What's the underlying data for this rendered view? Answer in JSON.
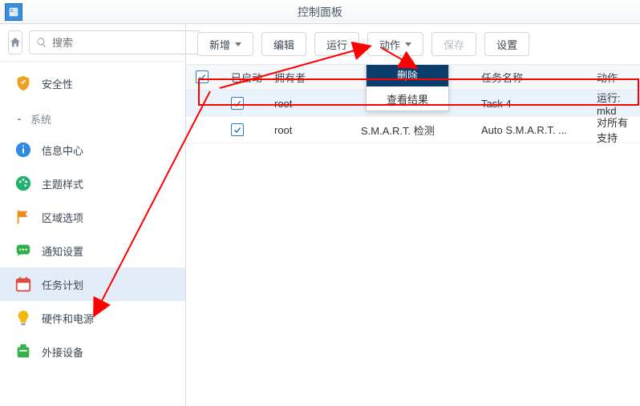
{
  "title": "控制面板",
  "search": {
    "placeholder": "搜索"
  },
  "sidebar": {
    "items": [
      {
        "label": "安全性"
      },
      {
        "label": "信息中心"
      },
      {
        "label": "主题样式"
      },
      {
        "label": "区域选项"
      },
      {
        "label": "通知设置"
      },
      {
        "label": "任务计划"
      },
      {
        "label": "硬件和电源"
      },
      {
        "label": "外接设备"
      }
    ],
    "group": "系统"
  },
  "toolbar": {
    "add": "新增",
    "edit": "编辑",
    "run": "运行",
    "action": "动作",
    "save": "保存",
    "settings": "设置"
  },
  "dropdown": {
    "delete": "删除",
    "view_result": "查看结果"
  },
  "table": {
    "headers": {
      "enabled": "已启动",
      "owner": "拥有者",
      "task_name": "任务名称",
      "action": "动作"
    },
    "rows": [
      {
        "enabled": true,
        "owner": "root",
        "type_masked": "",
        "name": "Task 4",
        "action": "运行: mkd"
      },
      {
        "enabled": true,
        "owner": "root",
        "type": "S.M.A.R.T. 检测",
        "name": "Auto S.M.A.R.T. ...",
        "action": "对所有支持"
      }
    ]
  }
}
